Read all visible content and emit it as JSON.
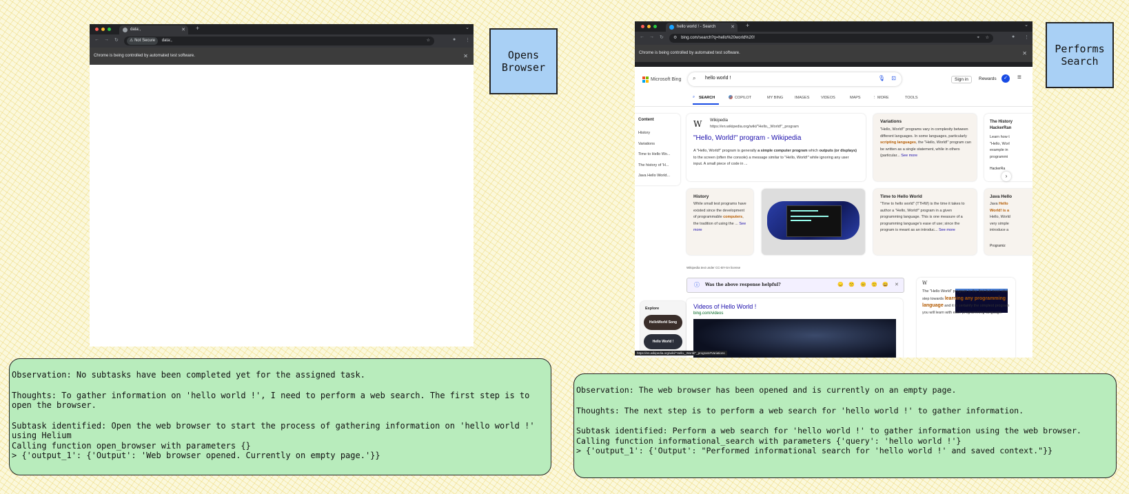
{
  "left": {
    "tab_title": "data:,",
    "url_security": "Not Secure",
    "url": "data:,",
    "infobar": "Chrome is being controlled by automated test software.",
    "label": [
      "Opens",
      "Browser"
    ],
    "log": {
      "observation": "Observation: No subtasks have been completed yet for the assigned task.",
      "thoughts": "Thoughts: To gather information on 'hello world !', I need to perform a web search. The first step is to open the browser.",
      "subtask": "Subtask identified: Open the web browser to start the process of gathering information on 'hello world !' using Helium",
      "call": "Calling function open_browser with parameters {}",
      "output": "> {'output_1': {'Output': 'Web browser opened. Currently on empty page.'}}"
    }
  },
  "right": {
    "tab_title": "hello world ! - Search",
    "url": "bing.com/search?q=hello%20world%20!",
    "infobar": "Chrome is being controlled by automated test software.",
    "label": [
      "Performs",
      "Search"
    ],
    "bing": {
      "logo": "Microsoft Bing",
      "query": "hello world !",
      "sign_in": "Sign in",
      "rewards": "Rewards",
      "nav": [
        "SEARCH",
        "COPILOT",
        "MY BING",
        "IMAGES",
        "VIDEOS",
        "MAPS",
        "⋮ MORE",
        "TOOLS"
      ],
      "content_title": "Content",
      "content_items": [
        "History",
        "Variations",
        "Time to Hello Wo...",
        "The history of 'H...",
        "Java Hello World..."
      ],
      "wiki_source": "Wikipedia",
      "wiki_url": "https://en.wikipedia.org/wiki/\"Hello,_World!\"_program",
      "wiki_title": "\"Hello, World!\" program - Wikipedia",
      "wiki_snippet_1": "A \"Hello, World!\" program is generally ",
      "wiki_snippet_b1": "a simple computer program",
      "wiki_snippet_2": " which ",
      "wiki_snippet_b2": "outputs (or displays)",
      "wiki_snippet_3": " to the screen (often the console) a message similar to \"Hello, World!\" while ignoring any user input. A small piece of code in ...",
      "variations_title": "Variations",
      "variations_text_1": "\"Hello, World!\" programs vary in complexity between different languages. In some languages, particularly ",
      "variations_bold": "scripting languages",
      "variations_text_2": ", the \"Hello, World!\" program can be written as a single statement, while in others (particular...",
      "see_more": "See more",
      "history_right_title": "The History HackerRan",
      "history_right_text": "Learn how t \"Hello, Worl example in programmi",
      "history_right_src": "HackerRa",
      "history_title": "History",
      "history_text_1": "While small test programs have existed since the development of programmable ",
      "history_bold": "computers",
      "history_text_2": ", the tradition of using the ...",
      "time_title": "Time to Hello World",
      "time_text": "\"Time to hello world\" (TTHW) is the time it takes to author a \"Hello, World!\" program in a given programming language. This is one measure of a programming language's ease of use; since the program is meant as an introduc...",
      "java_title": "Java Hello",
      "java_text_1": "Java ",
      "java_bold": "Hello World! is a",
      "java_text_2": " Hello, World very simple introduce a",
      "java_src": "Programiz",
      "license": "Wikipedia text under CC-BY-SA license",
      "feedback": "Was the above response helpful?",
      "feedback_icons": [
        "😞",
        "🙁",
        "😐",
        "🙂",
        "😀",
        "✕"
      ],
      "explore": "Explore",
      "explore_items": [
        "HelloWorld Song",
        "Hello World !"
      ],
      "videos_title": "Videos of Hello World !",
      "videos_source": "bing.com/videos",
      "side_text_1": "The \"Hello World\" program is the first but most vital step towards ",
      "side_bold": "learning any programming language",
      "side_text_2": " and it is certainly the simplest program you will learn with each programming language.",
      "status_url": "https://en.wikipedia.org/wiki/\"Hello,_World!\"_program#Variations"
    },
    "log": {
      "observation": "Observation: The web browser has been opened and is currently on an empty page.",
      "thoughts": "Thoughts: The next step is to perform a web search for 'hello world !' to gather information.",
      "subtask": "Subtask identified: Perform a web search for 'hello world !' to gather information using the web browser.",
      "call": "Calling function informational_search with parameters {'query': 'hello world !'}",
      "output": "> {'output_1': {'Output': \"Performed informational search for 'hello world !' and saved context.\"}}"
    }
  },
  "colors": {
    "background": "#fbf8dc",
    "label_fill": "#a9d0f5",
    "log_fill": "#b8ecbc",
    "chrome_dark": "#202124",
    "bing_blue": "#174ae4"
  }
}
